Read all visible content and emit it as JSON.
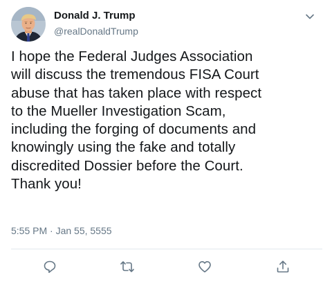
{
  "user": {
    "display_name": "Donald J. Trump",
    "handle": "@realDonaldTrump",
    "avatar_icon": "profile-avatar"
  },
  "tweet": {
    "text": "I hope the Federal Judges Association\nwill discuss the tremendous FISA Court\nabuse that has taken place with respect\nto the Mueller Investigation Scam,\nincluding the forging of documents and\nknowingly using the fake and totally\ndiscredited Dossier before the Court.\nThank you!",
    "timestamp": "5:55 PM · Jan 55, 5555"
  },
  "actions": [
    {
      "icon": "reply-icon"
    },
    {
      "icon": "retweet-icon"
    },
    {
      "icon": "like-icon"
    },
    {
      "icon": "share-icon"
    }
  ],
  "menu": {
    "icon": "chevron-down-icon"
  },
  "colors": {
    "text": "#14171a",
    "secondary": "#657786",
    "divider": "#e1e8ed"
  }
}
